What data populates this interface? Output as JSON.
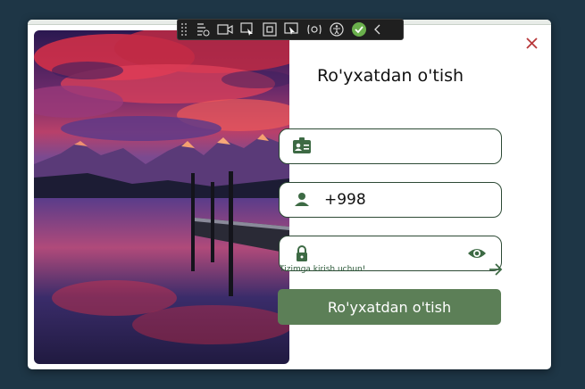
{
  "dialog": {
    "title": "Ro'yxatdan o'tish",
    "close_icon": "close-icon",
    "accent_color": "#5c7f57",
    "border_color": "#2d4a35"
  },
  "fields": {
    "id_card": {
      "icon": "id-card-icon",
      "value": ""
    },
    "phone": {
      "icon": "person-icon",
      "value": "+998"
    },
    "password": {
      "icon": "lock-icon",
      "value": "",
      "toggle_icon": "eye-icon"
    }
  },
  "login_link": {
    "label": "Tizimga kirish uchun!",
    "icon": "arrow-right-icon"
  },
  "submit": {
    "label": "Ro'yxatdan o'tish"
  },
  "toolbar": {
    "icons": [
      "grip-icon",
      "live-tree-icon",
      "video-icon",
      "select-element-icon",
      "display-layout-icon",
      "track-focus-icon",
      "hot-reload-icon",
      "accessibility-icon",
      "checkmark-icon",
      "collapse-chevron-icon"
    ]
  }
}
